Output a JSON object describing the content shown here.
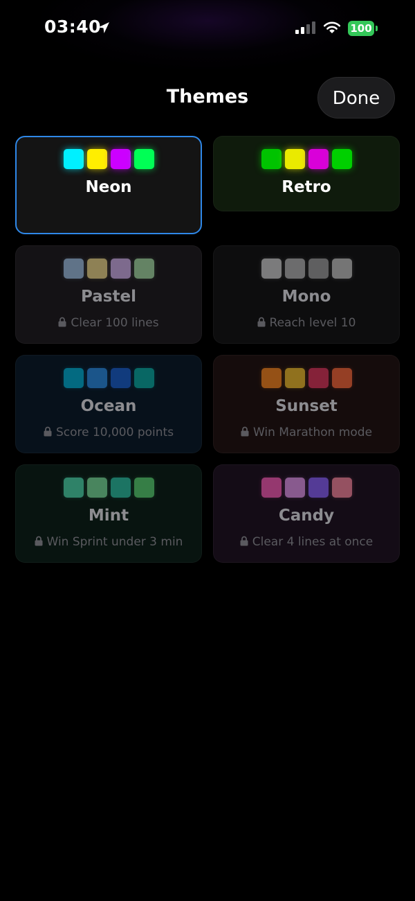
{
  "status_bar": {
    "time": "03:40",
    "battery": "100",
    "battery_color": "#34c759"
  },
  "header": {
    "title": "Themes",
    "done_label": "Done"
  },
  "accent_color": "#2f88e8",
  "themes": [
    {
      "name": "Neon",
      "state": "selected",
      "background": "#141414",
      "swatches": [
        "#00f0ff",
        "#ffee00",
        "#cc00ff",
        "#00ff55"
      ],
      "hint": ""
    },
    {
      "name": "Retro",
      "state": "unlocked",
      "background": "#0f1b0c",
      "swatches": [
        "#00c300",
        "#eaea00",
        "#d900d9",
        "#00d000"
      ],
      "hint": ""
    },
    {
      "name": "Pastel",
      "state": "locked",
      "background": "#141215",
      "swatches": [
        "#9fc3e6",
        "#f2dd8a",
        "#d3b2f0",
        "#a6e0a6"
      ],
      "hint": "Clear 100 lines"
    },
    {
      "name": "Mono",
      "state": "locked",
      "background": "#0d0d0e",
      "swatches": [
        "#d6d6d6",
        "#bbbbbb",
        "#a3a3a3",
        "#cacaca"
      ],
      "hint": "Reach level 10"
    },
    {
      "name": "Ocean",
      "state": "locked",
      "background": "#07111b",
      "swatches": [
        "#00b3d6",
        "#2c8ee6",
        "#1a5fce",
        "#0aaea0"
      ],
      "hint": "Score 10,000 points"
    },
    {
      "name": "Sunset",
      "state": "locked",
      "background": "#150c0c",
      "swatches": [
        "#ff8a1f",
        "#f5c52e",
        "#e2355f",
        "#ff6a3a"
      ],
      "hint": "Win Marathon mode"
    },
    {
      "name": "Mint",
      "state": "locked",
      "background": "#081410",
      "swatches": [
        "#4fdcb1",
        "#7fe29e",
        "#2ec3a8",
        "#5cd673"
      ],
      "hint": "Win Sprint under 3 min"
    },
    {
      "name": "Candy",
      "state": "locked",
      "background": "#140c16",
      "swatches": [
        "#ff5cb8",
        "#e79af0",
        "#8a62ff",
        "#ff8a9f"
      ],
      "hint": "Clear 4 lines at once"
    }
  ]
}
